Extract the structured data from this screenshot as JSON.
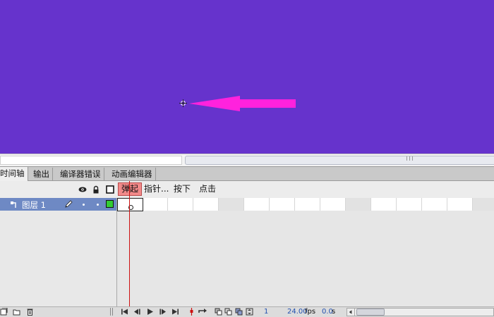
{
  "colors": {
    "stage_bg": "#6633cc",
    "arrow": "#ff22dd",
    "layer_selected": "#6e89c4",
    "playhead": "#cc1111",
    "frame_label_bg": "#f28a8a",
    "layer_outline_color": "#33cc33"
  },
  "stage": {
    "arrow_icon": "arrow-shape-left",
    "crosshair_icon": "registration-crosshair-icon"
  },
  "tabs": [
    {
      "label": "时间轴",
      "active": true
    },
    {
      "label": "输出",
      "active": false
    },
    {
      "label": "编译器错误",
      "active": false
    },
    {
      "label": "动画编辑器",
      "active": false
    }
  ],
  "header": {
    "icons": [
      "eye-icon",
      "lock-icon",
      "outline-icon"
    ],
    "frame_labels": [
      "弹起",
      "指针...",
      "按下",
      "点击"
    ]
  },
  "layers": [
    {
      "name": "图层 1",
      "selected": true,
      "type_icon": "layer-type-icon",
      "edit_icon": "pencil-icon"
    }
  ],
  "bottom_bar": {
    "current_frame": "1",
    "fps_value": "24.00",
    "fps_unit": "fps",
    "time_value": "0.0",
    "time_unit": "s"
  }
}
